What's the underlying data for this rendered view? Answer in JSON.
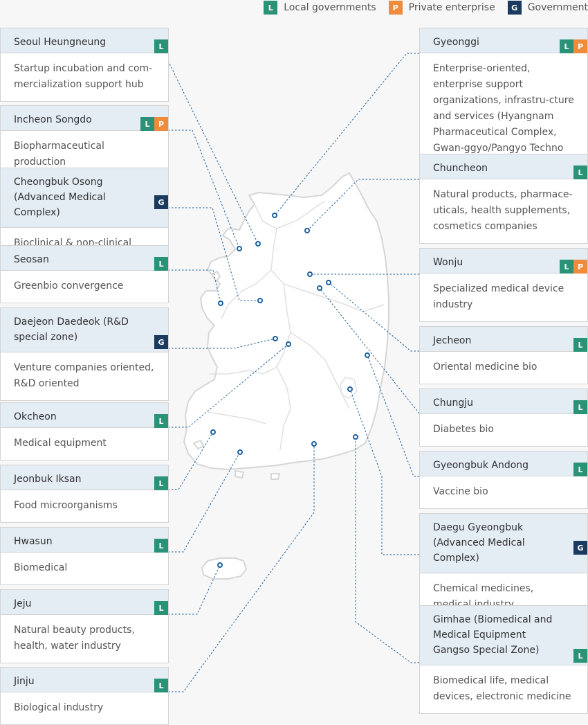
{
  "legend": [
    {
      "code": "L",
      "label": "Local governments"
    },
    {
      "code": "P",
      "label": "Private enterprise"
    },
    {
      "code": "G",
      "label": "Government"
    }
  ],
  "colors": {
    "L": "#2a9377",
    "P": "#ef8b3a",
    "G": "#1a3a5f",
    "header": "#e4ecf4",
    "line": "#1a5f9e"
  },
  "clusters": [
    {
      "id": "seoul",
      "name": "Seoul Heungneung",
      "badges": [
        "L"
      ],
      "desc": "Startup incubation and com-mercialization support hub"
    },
    {
      "id": "incheon",
      "name": "Incheon Songdo",
      "badges": [
        "L",
        "P"
      ],
      "desc": "Biopharmaceutical production"
    },
    {
      "id": "osong",
      "name": "Cheongbuk Osong (Advanced Medical Complex)",
      "badges": [
        "G"
      ],
      "desc": "Bioclinical & non-clinical"
    },
    {
      "id": "seosan",
      "name": "Seosan",
      "badges": [
        "L"
      ],
      "desc": "Greenbio convergence"
    },
    {
      "id": "daedeok",
      "name": "Daejeon Daedeok (R&D special zone)",
      "badges": [
        "G"
      ],
      "desc": "Venture companies oriented, R&D oriented"
    },
    {
      "id": "okcheon",
      "name": "Okcheon",
      "badges": [
        "L"
      ],
      "desc": "Medical equipment"
    },
    {
      "id": "iksan",
      "name": "Jeonbuk Iksan",
      "badges": [
        "L"
      ],
      "desc": "Food microorganisms"
    },
    {
      "id": "hwasun",
      "name": "Hwasun",
      "badges": [
        "L"
      ],
      "desc": "Biomedical"
    },
    {
      "id": "jeju",
      "name": "Jeju",
      "badges": [
        "L"
      ],
      "desc": "Natural beauty products, health, water industry"
    },
    {
      "id": "jinju",
      "name": "Jinju",
      "badges": [
        "L"
      ],
      "desc": "Biological industry"
    },
    {
      "id": "gyeonggi",
      "name": "Gyeonggi",
      "badges": [
        "L",
        "P"
      ],
      "desc": "Enterprise-oriented, enterprise support organizations, infrastru-cture and services (Hyangnam Pharmaceutical Complex, Gwan-ggyo/Pangyo Techno Valley)"
    },
    {
      "id": "chuncheon",
      "name": "Chuncheon",
      "badges": [
        "L"
      ],
      "desc": "Natural products, pharmace-uticals, health supplements, cosmetics companies"
    },
    {
      "id": "wonju",
      "name": "Wonju",
      "badges": [
        "L",
        "P"
      ],
      "desc": "Specialized medical device industry"
    },
    {
      "id": "jecheon",
      "name": "Jecheon",
      "badges": [
        "L"
      ],
      "desc": "Oriental medicine bio"
    },
    {
      "id": "chungju",
      "name": "Chungju",
      "badges": [
        "L"
      ],
      "desc": "Diabetes bio"
    },
    {
      "id": "andong",
      "name": "Gyeongbuk Andong",
      "badges": [
        "L"
      ],
      "desc": "Vaccine bio"
    },
    {
      "id": "daegu",
      "name": "Daegu Gyeongbuk (Advanced Medical Complex)",
      "badges": [
        "G"
      ],
      "desc": "Chemical medicines, medical industry"
    },
    {
      "id": "gimhae",
      "name": "Gimhae (Biomedical and Medical Equipment Gangso Special Zone)",
      "badges": [
        "L"
      ],
      "desc": "Biomedical life, medical devices, electronic medicine"
    }
  ]
}
